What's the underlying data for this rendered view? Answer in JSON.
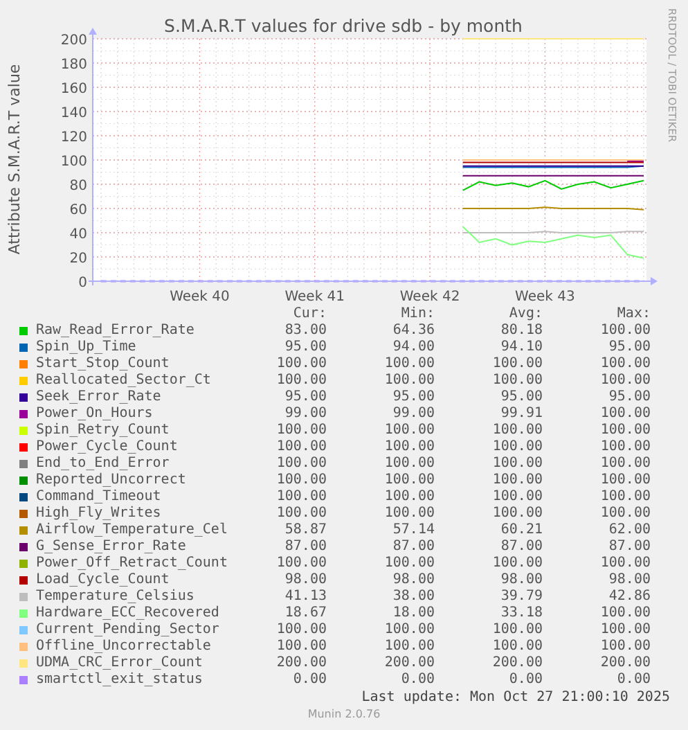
{
  "chart": {
    "side_note": "RRDTOOL / TOBI OETIKER",
    "chart_data": {
      "type": "line",
      "title": "S.M.A.R.T values for drive sdb - by month",
      "ylabel": "Attribute S.M.A.R.T value",
      "grid": true,
      "categories": [
        null,
        null,
        null,
        null,
        null,
        null,
        "Week 40",
        null,
        null,
        null,
        null,
        null,
        null,
        "Week 41",
        null,
        null,
        null,
        null,
        null,
        null,
        "Week 42",
        null,
        null,
        null,
        null,
        null,
        null,
        "Week 43",
        null,
        null,
        null,
        null,
        null,
        null
      ],
      "ylim": [
        0,
        200
      ],
      "yticks": [
        0,
        20,
        40,
        60,
        80,
        100,
        120,
        140,
        160,
        180,
        200
      ],
      "series": [
        {
          "name": "Raw_Read_Error_Rate",
          "color": "#00cc00",
          "values": [
            null,
            null,
            null,
            null,
            null,
            null,
            null,
            null,
            null,
            null,
            null,
            null,
            null,
            null,
            null,
            null,
            null,
            null,
            null,
            null,
            null,
            null,
            75,
            82,
            79,
            81,
            78,
            83,
            76,
            80,
            82,
            77,
            80,
            83
          ]
        },
        {
          "name": "Spin_Up_Time",
          "color": "#0066b3",
          "values": [
            null,
            null,
            null,
            null,
            null,
            null,
            null,
            null,
            null,
            null,
            null,
            null,
            null,
            null,
            null,
            null,
            null,
            null,
            null,
            null,
            null,
            null,
            94,
            94,
            94,
            94,
            94,
            94,
            94,
            94,
            94,
            94,
            94,
            95
          ]
        },
        {
          "name": "Start_Stop_Count",
          "color": "#ff8000",
          "values": [
            null,
            null,
            null,
            null,
            null,
            null,
            null,
            null,
            null,
            null,
            null,
            null,
            null,
            null,
            null,
            null,
            null,
            null,
            null,
            null,
            null,
            null,
            null,
            null,
            null,
            null,
            null,
            null,
            null,
            null,
            null,
            null,
            null,
            null
          ]
        },
        {
          "name": "Reallocated_Sector_Ct",
          "color": "#ffcc00",
          "values": [
            null,
            null,
            null,
            null,
            null,
            null,
            null,
            null,
            null,
            null,
            null,
            null,
            null,
            null,
            null,
            null,
            null,
            null,
            null,
            null,
            null,
            null,
            null,
            null,
            null,
            null,
            null,
            null,
            null,
            null,
            null,
            null,
            null,
            null
          ]
        },
        {
          "name": "Seek_Error_Rate",
          "color": "#330099",
          "values": [
            null,
            null,
            null,
            null,
            null,
            null,
            null,
            null,
            null,
            null,
            null,
            null,
            null,
            null,
            null,
            null,
            null,
            null,
            null,
            null,
            null,
            null,
            95,
            95,
            95,
            95,
            95,
            95,
            95,
            95,
            95,
            95,
            95,
            95
          ]
        },
        {
          "name": "Power_On_Hours",
          "color": "#990099",
          "values": [
            null,
            null,
            null,
            null,
            null,
            null,
            null,
            null,
            null,
            null,
            null,
            null,
            null,
            null,
            null,
            null,
            null,
            null,
            null,
            null,
            null,
            null,
            null,
            null,
            null,
            null,
            null,
            null,
            null,
            null,
            null,
            null,
            99,
            99
          ]
        },
        {
          "name": "Spin_Retry_Count",
          "color": "#ccff00",
          "values": [
            null,
            null,
            null,
            null,
            null,
            null,
            null,
            null,
            null,
            null,
            null,
            null,
            null,
            null,
            null,
            null,
            null,
            null,
            null,
            null,
            null,
            null,
            null,
            null,
            null,
            null,
            null,
            null,
            null,
            null,
            null,
            null,
            null,
            null
          ]
        },
        {
          "name": "Power_Cycle_Count",
          "color": "#ff0000",
          "values": [
            null,
            null,
            null,
            null,
            null,
            null,
            null,
            null,
            null,
            null,
            null,
            null,
            null,
            null,
            null,
            null,
            null,
            null,
            null,
            null,
            null,
            null,
            null,
            null,
            null,
            null,
            null,
            null,
            null,
            null,
            null,
            null,
            null,
            null
          ]
        },
        {
          "name": "End_to_End_Error",
          "color": "#808080",
          "values": [
            null,
            null,
            null,
            null,
            null,
            null,
            null,
            null,
            null,
            null,
            null,
            null,
            null,
            null,
            null,
            null,
            null,
            null,
            null,
            null,
            null,
            null,
            null,
            null,
            null,
            null,
            null,
            null,
            null,
            null,
            null,
            null,
            null,
            null
          ]
        },
        {
          "name": "Reported_Uncorrect",
          "color": "#008f00",
          "values": [
            null,
            null,
            null,
            null,
            null,
            null,
            null,
            null,
            null,
            null,
            null,
            null,
            null,
            null,
            null,
            null,
            null,
            null,
            null,
            null,
            null,
            null,
            null,
            null,
            null,
            null,
            null,
            null,
            null,
            null,
            null,
            null,
            null,
            null
          ]
        },
        {
          "name": "Command_Timeout",
          "color": "#00487d",
          "values": [
            null,
            null,
            null,
            null,
            null,
            null,
            null,
            null,
            null,
            null,
            null,
            null,
            null,
            null,
            null,
            null,
            null,
            null,
            null,
            null,
            null,
            null,
            null,
            null,
            null,
            null,
            null,
            null,
            null,
            null,
            null,
            null,
            null,
            null
          ]
        },
        {
          "name": "High_Fly_Writes",
          "color": "#b35a00",
          "values": [
            null,
            null,
            null,
            null,
            null,
            null,
            null,
            null,
            null,
            null,
            null,
            null,
            null,
            null,
            null,
            null,
            null,
            null,
            null,
            null,
            null,
            null,
            null,
            null,
            null,
            null,
            null,
            null,
            null,
            null,
            null,
            null,
            null,
            null
          ]
        },
        {
          "name": "Airflow_Temperature_Cel",
          "color": "#b38f00",
          "values": [
            null,
            null,
            null,
            null,
            null,
            null,
            null,
            null,
            null,
            null,
            null,
            null,
            null,
            null,
            null,
            null,
            null,
            null,
            null,
            null,
            null,
            null,
            60,
            60,
            60,
            60,
            60,
            61,
            60,
            60,
            60,
            60,
            60,
            59
          ]
        },
        {
          "name": "G_Sense_Error_Rate",
          "color": "#6b006b",
          "values": [
            null,
            null,
            null,
            null,
            null,
            null,
            null,
            null,
            null,
            null,
            null,
            null,
            null,
            null,
            null,
            null,
            null,
            null,
            null,
            null,
            null,
            null,
            87,
            87,
            87,
            87,
            87,
            87,
            87,
            87,
            87,
            87,
            87,
            87
          ]
        },
        {
          "name": "Power_Off_Retract_Count",
          "color": "#8fb300",
          "values": [
            null,
            null,
            null,
            null,
            null,
            null,
            null,
            null,
            null,
            null,
            null,
            null,
            null,
            null,
            null,
            null,
            null,
            null,
            null,
            null,
            null,
            null,
            null,
            null,
            null,
            null,
            null,
            null,
            null,
            null,
            null,
            null,
            null,
            null
          ]
        },
        {
          "name": "Load_Cycle_Count",
          "color": "#b30000",
          "values": [
            null,
            null,
            null,
            null,
            null,
            null,
            null,
            null,
            null,
            null,
            null,
            null,
            null,
            null,
            null,
            null,
            null,
            null,
            null,
            null,
            null,
            null,
            98,
            98,
            98,
            98,
            98,
            98,
            98,
            98,
            98,
            98,
            98,
            98
          ]
        },
        {
          "name": "Temperature_Celsius",
          "color": "#bebebe",
          "values": [
            null,
            null,
            null,
            null,
            null,
            null,
            null,
            null,
            null,
            null,
            null,
            null,
            null,
            null,
            null,
            null,
            null,
            null,
            null,
            null,
            null,
            null,
            40,
            40,
            40,
            40,
            40,
            41,
            40,
            40,
            40,
            40,
            41,
            41
          ]
        },
        {
          "name": "Hardware_ECC_Recovered",
          "color": "#80ff80",
          "values": [
            null,
            null,
            null,
            null,
            null,
            null,
            null,
            null,
            null,
            null,
            null,
            null,
            null,
            null,
            null,
            null,
            null,
            null,
            null,
            null,
            null,
            null,
            45,
            32,
            35,
            30,
            33,
            32,
            35,
            38,
            36,
            38,
            22,
            19
          ]
        },
        {
          "name": "Current_Pending_Sector",
          "color": "#80c9ff",
          "values": [
            null,
            null,
            null,
            null,
            null,
            null,
            null,
            null,
            null,
            null,
            null,
            null,
            null,
            null,
            null,
            null,
            null,
            null,
            null,
            null,
            null,
            null,
            null,
            null,
            null,
            null,
            null,
            null,
            null,
            null,
            null,
            null,
            null,
            null
          ]
        },
        {
          "name": "Offline_Uncorrectable",
          "color": "#ffc080",
          "values": [
            null,
            null,
            null,
            null,
            null,
            null,
            null,
            null,
            null,
            null,
            null,
            null,
            null,
            null,
            null,
            null,
            null,
            null,
            null,
            null,
            null,
            null,
            100,
            100,
            100,
            100,
            100,
            100,
            100,
            100,
            100,
            100,
            100,
            100
          ]
        },
        {
          "name": "UDMA_CRC_Error_Count",
          "color": "#ffe680",
          "values": [
            null,
            null,
            null,
            null,
            null,
            null,
            null,
            null,
            null,
            null,
            null,
            null,
            null,
            null,
            null,
            null,
            null,
            null,
            null,
            null,
            null,
            null,
            200,
            200,
            200,
            200,
            200,
            200,
            200,
            200,
            200,
            200,
            200,
            200
          ]
        },
        {
          "name": "smartctl_exit_status",
          "color": "#aa80ff",
          "line_style": "dashed",
          "values": [
            0,
            0,
            0,
            0,
            0,
            0,
            0,
            0,
            0,
            0,
            0,
            0,
            0,
            0,
            0,
            0,
            0,
            0,
            0,
            0,
            0,
            0,
            0,
            0,
            0,
            0,
            0,
            0,
            0,
            0,
            0,
            0,
            0,
            0
          ]
        }
      ]
    }
  },
  "legend": {
    "columns": [
      "Cur:",
      "Min:",
      "Avg:",
      "Max:"
    ],
    "rows": [
      {
        "cur": "83.00",
        "min": "64.36",
        "avg": "80.18",
        "max": "100.00"
      },
      {
        "cur": "95.00",
        "min": "94.00",
        "avg": "94.10",
        "max": "95.00"
      },
      {
        "cur": "100.00",
        "min": "100.00",
        "avg": "100.00",
        "max": "100.00"
      },
      {
        "cur": "100.00",
        "min": "100.00",
        "avg": "100.00",
        "max": "100.00"
      },
      {
        "cur": "95.00",
        "min": "95.00",
        "avg": "95.00",
        "max": "95.00"
      },
      {
        "cur": "99.00",
        "min": "99.00",
        "avg": "99.91",
        "max": "100.00"
      },
      {
        "cur": "100.00",
        "min": "100.00",
        "avg": "100.00",
        "max": "100.00"
      },
      {
        "cur": "100.00",
        "min": "100.00",
        "avg": "100.00",
        "max": "100.00"
      },
      {
        "cur": "100.00",
        "min": "100.00",
        "avg": "100.00",
        "max": "100.00"
      },
      {
        "cur": "100.00",
        "min": "100.00",
        "avg": "100.00",
        "max": "100.00"
      },
      {
        "cur": "100.00",
        "min": "100.00",
        "avg": "100.00",
        "max": "100.00"
      },
      {
        "cur": "100.00",
        "min": "100.00",
        "avg": "100.00",
        "max": "100.00"
      },
      {
        "cur": "58.87",
        "min": "57.14",
        "avg": "60.21",
        "max": "62.00"
      },
      {
        "cur": "87.00",
        "min": "87.00",
        "avg": "87.00",
        "max": "87.00"
      },
      {
        "cur": "100.00",
        "min": "100.00",
        "avg": "100.00",
        "max": "100.00"
      },
      {
        "cur": "98.00",
        "min": "98.00",
        "avg": "98.00",
        "max": "98.00"
      },
      {
        "cur": "41.13",
        "min": "38.00",
        "avg": "39.79",
        "max": "42.86"
      },
      {
        "cur": "18.67",
        "min": "18.00",
        "avg": "33.18",
        "max": "100.00"
      },
      {
        "cur": "100.00",
        "min": "100.00",
        "avg": "100.00",
        "max": "100.00"
      },
      {
        "cur": "100.00",
        "min": "100.00",
        "avg": "100.00",
        "max": "100.00"
      },
      {
        "cur": "200.00",
        "min": "200.00",
        "avg": "200.00",
        "max": "200.00"
      },
      {
        "cur": "0.00",
        "min": "0.00",
        "avg": "0.00",
        "max": "0.00"
      }
    ]
  },
  "last_update": "Last update: Mon Oct 27 21:00:10 2025",
  "footer": "Munin 2.0.76"
}
